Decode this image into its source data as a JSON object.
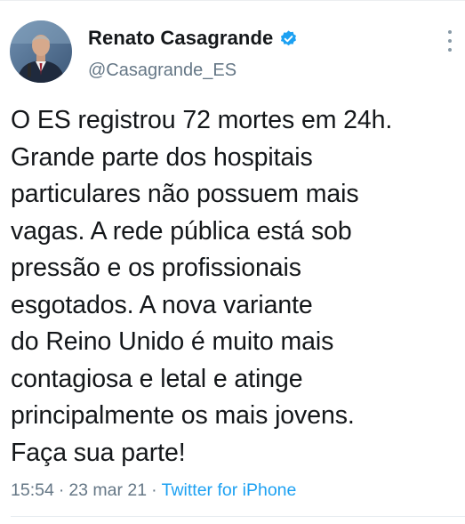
{
  "author": {
    "display_name": "Renato Casagrande",
    "handle": "@Casagrande_ES",
    "verified": true,
    "avatar_icon": "profile-photo",
    "verified_icon": "verified-badge-icon"
  },
  "tweet": {
    "text": "O ES registrou 72 mortes em 24h.\nGrande parte dos hospitais\nparticulares não possuem mais\nvagas. A rede pública está sob\npressão e os profissionais\nesgotados. A nova variante\ndo Reino Unido é muito mais\ncontagiosa e letal e atinge\nprincipalmente os mais jovens.\nFaça sua parte!",
    "time": "15:54",
    "date": "23 mar 21",
    "source": "Twitter for iPhone",
    "separator": "·"
  },
  "actions": {
    "more_icon": "more-vertical-icon"
  },
  "colors": {
    "text": "#14171a",
    "secondary": "#657786",
    "accent": "#1da1f2"
  }
}
